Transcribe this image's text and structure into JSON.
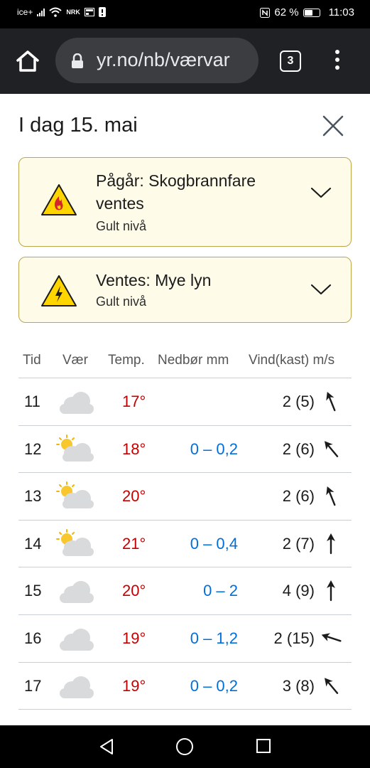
{
  "status_bar": {
    "carrier": "ice+",
    "carrier2": "NRK",
    "battery": "62 %",
    "battery_level": 0.62,
    "time": "11:03"
  },
  "browser": {
    "url": "yr.no/nb/værvar",
    "tab_count": "3"
  },
  "page": {
    "title": "I dag 15. mai"
  },
  "warnings": [
    {
      "title_line1": "Pågår: Skogbrannfare",
      "title_line2": "ventes",
      "level": "Gult nivå",
      "icon": "forest-fire-warning-icon"
    },
    {
      "title_line1": "Ventes: Mye lyn",
      "title_line2": "",
      "level": "Gult nivå",
      "icon": "lightning-warning-icon"
    }
  ],
  "table": {
    "headers": {
      "time": "Tid",
      "weather": "Vær",
      "temp": "Temp.",
      "precip": "Nedbør mm",
      "wind": "Vind(kast) m/s"
    },
    "rows": [
      {
        "time": "11",
        "icon": "cloudy",
        "temp": "17°",
        "precip": "",
        "wind": "2 (5)",
        "direction": "north-northwest"
      },
      {
        "time": "12",
        "icon": "partly-cloudy",
        "temp": "18°",
        "precip": "0 – 0,2",
        "wind": "2 (6)",
        "direction": "northwest"
      },
      {
        "time": "13",
        "icon": "partly-cloudy",
        "temp": "20°",
        "precip": "",
        "wind": "2 (6)",
        "direction": "north-northwest"
      },
      {
        "time": "14",
        "icon": "partly-cloudy",
        "temp": "21°",
        "precip": "0 – 0,4",
        "wind": "2 (7)",
        "direction": "north"
      },
      {
        "time": "15",
        "icon": "cloudy",
        "temp": "20°",
        "precip": "0 – 2",
        "wind": "4 (9)",
        "direction": "north"
      },
      {
        "time": "16",
        "icon": "cloudy",
        "temp": "19°",
        "precip": "0 – 1,2",
        "wind": "2 (15)",
        "direction": "west-northwest"
      },
      {
        "time": "17",
        "icon": "cloudy",
        "temp": "19°",
        "precip": "0 – 0,2",
        "wind": "3 (8)",
        "direction": "northwest"
      }
    ]
  },
  "colors": {
    "temp_warm": "#c60000",
    "precip": "#006edb",
    "warning_bg": "#fefce9",
    "warning_border": "#bca647",
    "warning_yellow": "#ffd500"
  }
}
